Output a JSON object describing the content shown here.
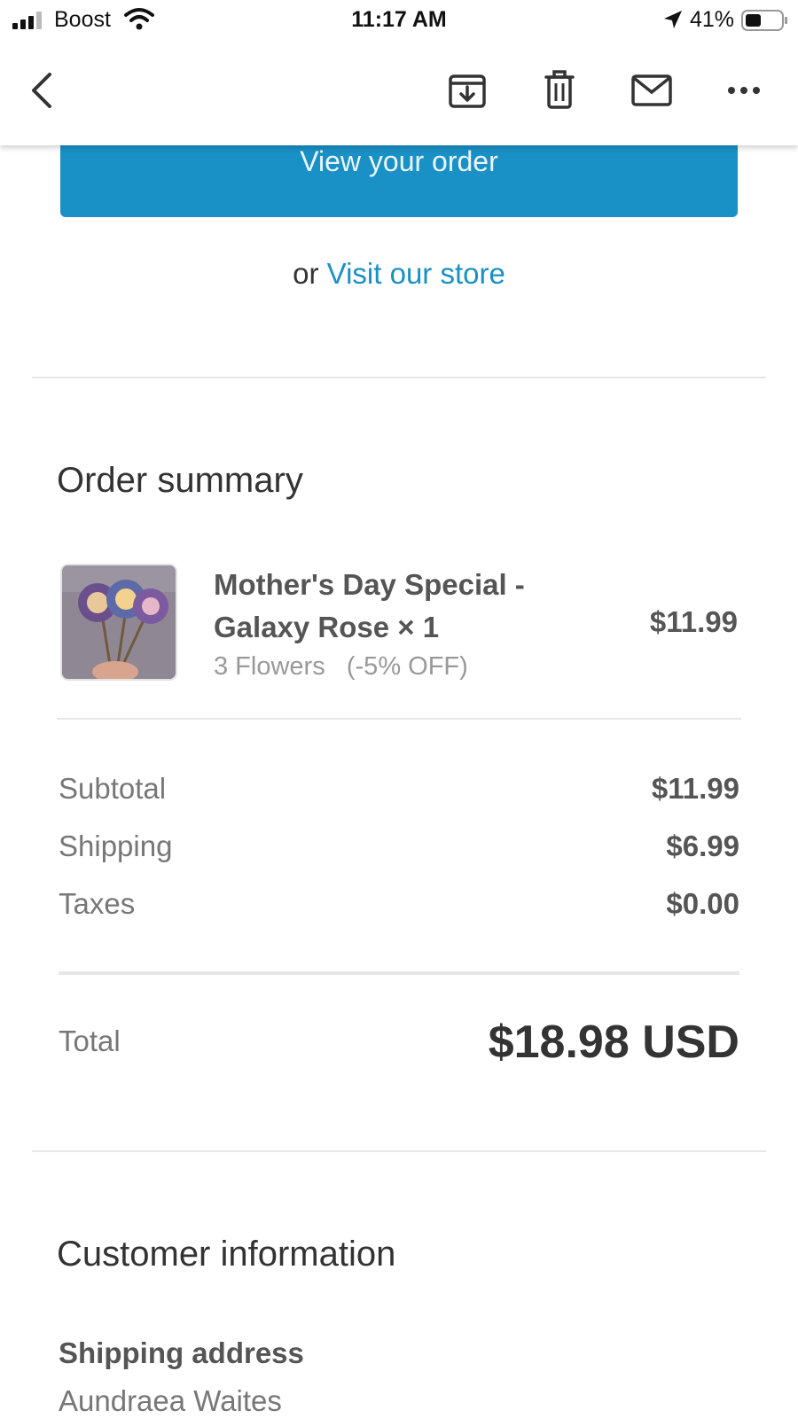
{
  "status_bar": {
    "carrier": "Boost",
    "time": "11:17 AM",
    "battery": "41%"
  },
  "toolbar": {
    "icons": [
      "back-icon",
      "archive-icon",
      "trash-icon",
      "mail-icon",
      "more-icon"
    ]
  },
  "email": {
    "view_order_label": "View your order",
    "or_text": "or",
    "visit_store_label": "Visit our store"
  },
  "order_summary": {
    "title": "Order summary",
    "items": [
      {
        "name": "Mother's Day Special - Galaxy Rose × 1",
        "variant": "3 Flowers   (-5% OFF)",
        "price": "$11.99"
      }
    ],
    "subtotal_label": "Subtotal",
    "subtotal_value": "$11.99",
    "shipping_label": "Shipping",
    "shipping_value": "$6.99",
    "taxes_label": "Taxes",
    "taxes_value": "$0.00",
    "total_label": "Total",
    "total_value": "$18.98 USD"
  },
  "customer_info": {
    "title": "Customer information",
    "shipping_address_label": "Shipping address",
    "name": "Aundraea Waites"
  },
  "colors": {
    "accent": "#1990c6",
    "divider": "#e6e6e6"
  }
}
